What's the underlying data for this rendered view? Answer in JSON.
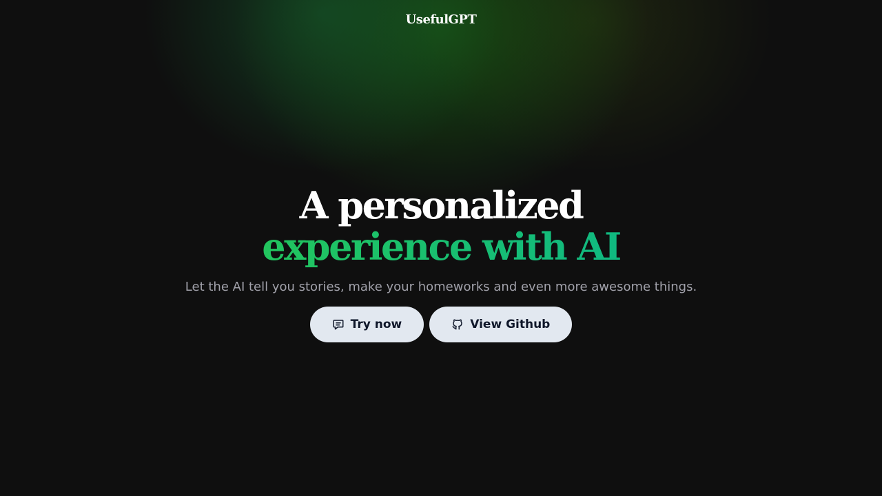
{
  "header": {
    "brand": "UsefulGPT"
  },
  "hero": {
    "headline_line1": "A personalized",
    "headline_line2": "experience with AI",
    "subtitle": "Let the AI tell you stories, make your homeworks and even more awesome things."
  },
  "actions": {
    "try_now": {
      "label": "Try now",
      "icon": "chat-bubble-icon"
    },
    "view_github": {
      "label": "View Github",
      "icon": "github-icon"
    }
  },
  "colors": {
    "background": "#0f0f0f",
    "accent_start": "#22c55e",
    "accent_end": "#10b981",
    "button_bg": "#e2e8f0",
    "button_text": "#0f172a",
    "subtitle_text": "#a1a1aa"
  }
}
